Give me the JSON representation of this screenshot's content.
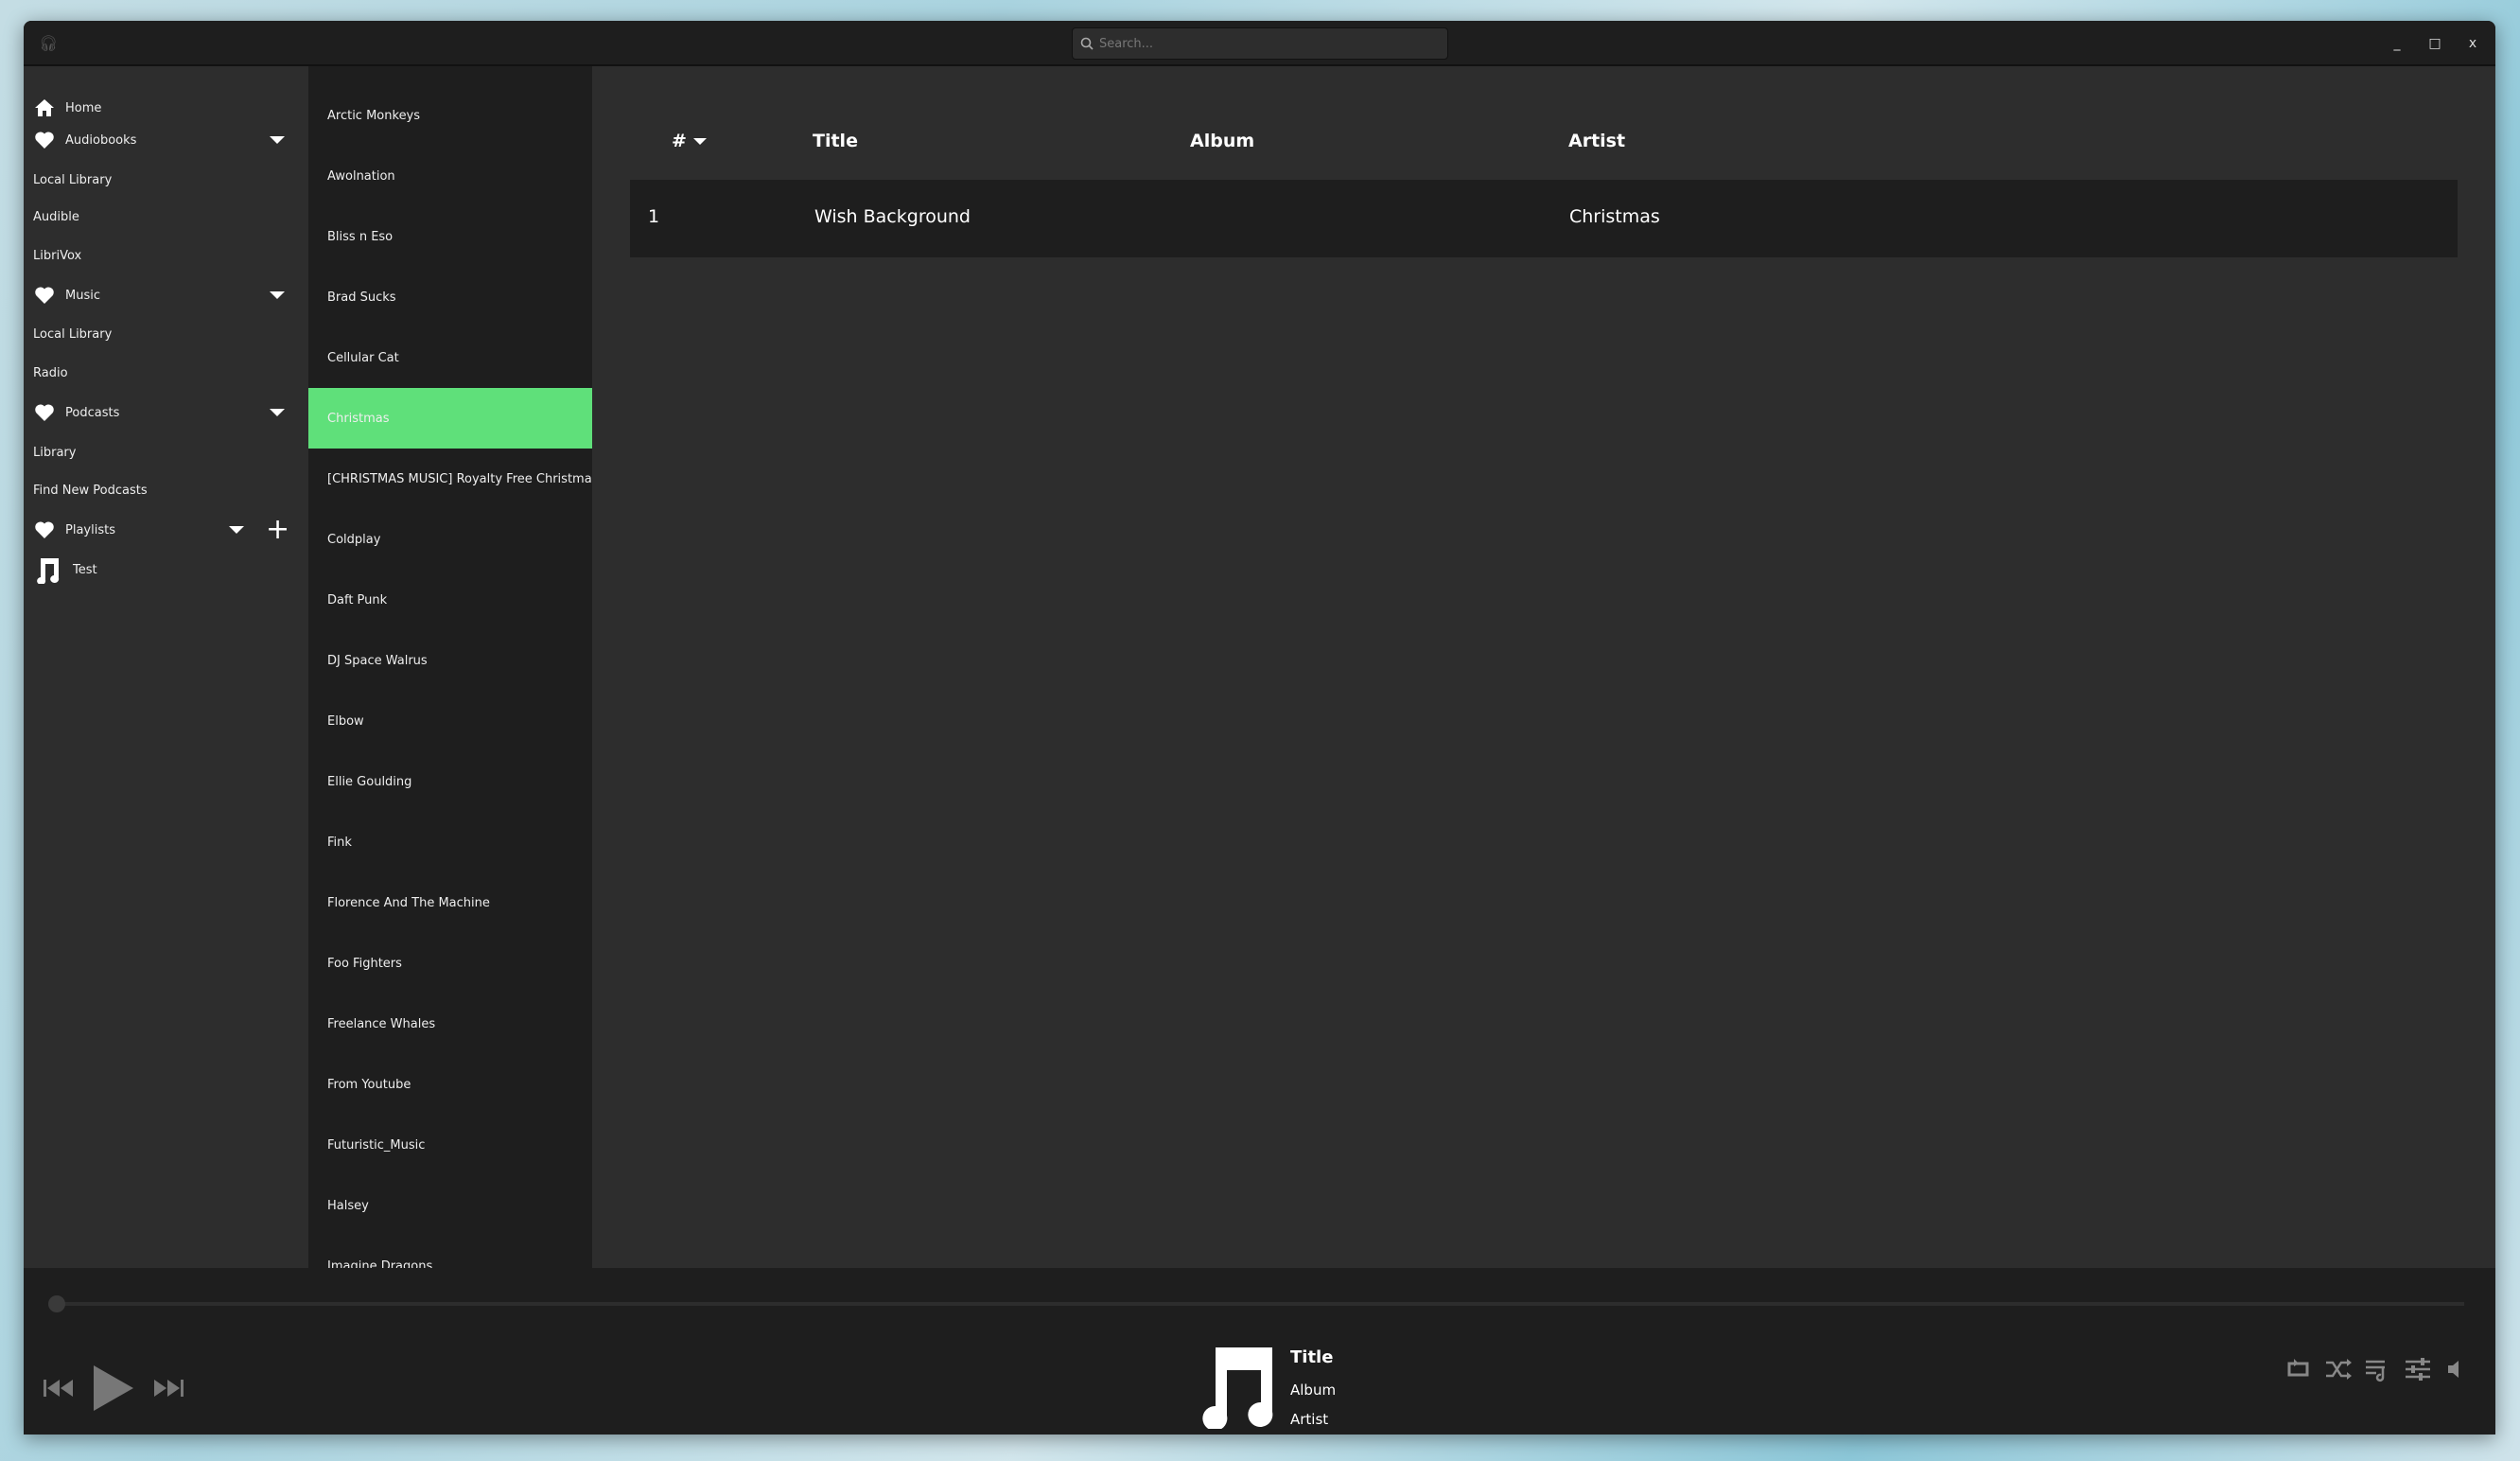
{
  "titlebar": {
    "app_icon": "headphones-icon",
    "search_placeholder": "Search...",
    "minimize": "_",
    "maximize": "□",
    "close": "x"
  },
  "sidebar": {
    "home": "Home",
    "audiobooks": {
      "label": "Audiobooks",
      "items": [
        "Local Library",
        "Audible",
        "LibriVox"
      ]
    },
    "music": {
      "label": "Music",
      "items": [
        "Local Library",
        "Radio"
      ]
    },
    "podcasts": {
      "label": "Podcasts",
      "items": [
        "Library",
        "Find New Podcasts"
      ]
    },
    "playlists": {
      "label": "Playlists",
      "items": [
        "Test"
      ]
    }
  },
  "artists": {
    "selected": "Christmas",
    "items": [
      "Arctic Monkeys",
      "Awolnation",
      "Bliss n Eso",
      "Brad Sucks",
      "Cellular Cat",
      "Christmas",
      "[CHRISTMAS MUSIC] Royalty Free Christmas Music",
      "Coldplay",
      "Daft Punk",
      "DJ Space Walrus",
      "Elbow",
      "Ellie Goulding",
      "Fink",
      "Florence And The Machine",
      "Foo Fighters",
      "Freelance Whales",
      "From Youtube",
      "Futuristic_Music",
      "Halsey",
      "Imagine Dragons"
    ]
  },
  "table": {
    "columns": [
      "#",
      "Title",
      "Album",
      "Artist"
    ],
    "sort_column": "#",
    "rows": [
      {
        "num": "1",
        "title": "Wish Background",
        "album": "",
        "artist": "Christmas"
      }
    ]
  },
  "player": {
    "title": "Title",
    "album": "Album",
    "artist": "Artist",
    "progress": 0
  },
  "colors": {
    "accent": "#5fe07a",
    "sidebar": "#2d2d2d",
    "list": "#1e1e1e"
  }
}
